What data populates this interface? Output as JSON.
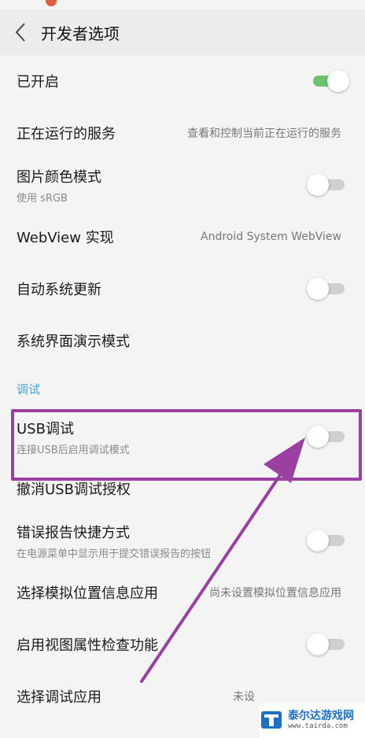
{
  "header": {
    "title": "开发者选项"
  },
  "rows_top": [
    {
      "label": "已开启",
      "toggle": "on"
    },
    {
      "label": "正在运行的服务",
      "value": "查看和控制当前正在运行的服务"
    },
    {
      "label": "图片颜色模式",
      "sub": "使用 sRGB",
      "toggle": "off"
    },
    {
      "label": "WebView 实现",
      "value": "Android System WebView"
    },
    {
      "label": "自动系统更新",
      "toggle": "off"
    },
    {
      "label": "系统界面演示模式"
    }
  ],
  "section": {
    "label": "调试"
  },
  "rows_debug": [
    {
      "label": "USB调试",
      "sub": "连接USB后启用调试模式",
      "toggle": "off"
    },
    {
      "label": "撤消USB调试授权"
    },
    {
      "label": "错误报告快捷方式",
      "sub": "在电源菜单中显示用于提交错误报告的按钮",
      "toggle": "off"
    },
    {
      "label": "选择模拟位置信息应用",
      "value": "尚未设置模拟位置信息应用"
    },
    {
      "label": "启用视图属性检查功能",
      "toggle": "off"
    },
    {
      "label": "选择调试应用",
      "value": "未设"
    }
  ],
  "annotation": {
    "highlight_color": "#9b3fa1"
  },
  "watermark": {
    "name": "泰尔达游戏网",
    "url": "www.tairda.com"
  }
}
